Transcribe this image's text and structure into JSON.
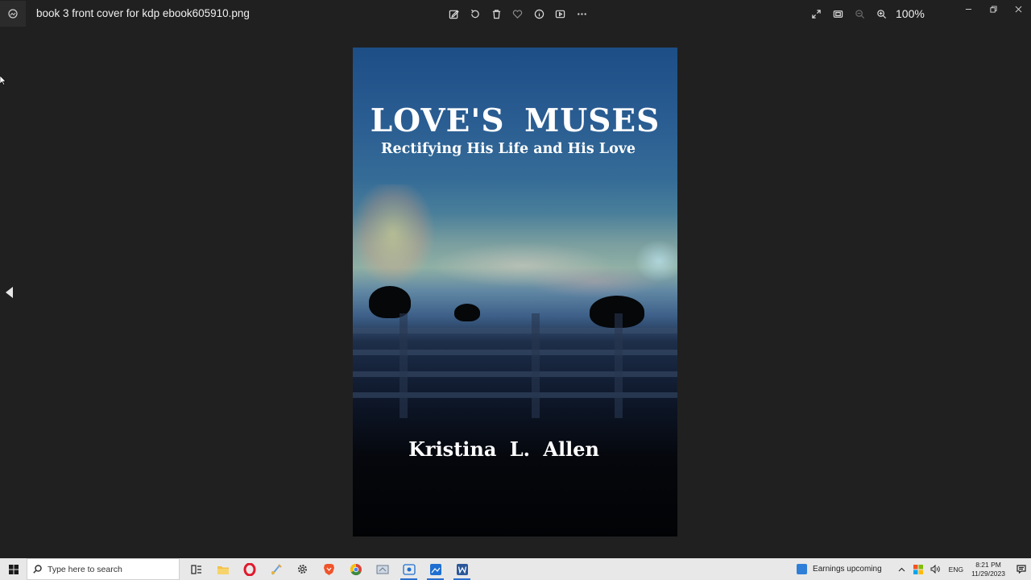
{
  "window": {
    "title": "book 3 front cover for kdp ebook605910.png",
    "zoom": "100%"
  },
  "toolbar": {
    "buttons": [
      "edit-icon",
      "rotate-icon",
      "delete-icon",
      "favorite-icon",
      "info-icon",
      "slideshow-icon",
      "more-icon"
    ]
  },
  "cover": {
    "title": "LOVE'S  MUSES",
    "subtitle": "Rectifying His Life and His Love",
    "author": "Kristina  L.  Allen"
  },
  "taskbar": {
    "search_placeholder": "Type here to search",
    "news": "Earnings upcoming",
    "language": "ENG",
    "time": "8:21 PM",
    "date": "11/29/2023",
    "colors": {
      "opera": "#e0192b",
      "brave": "#f0542a",
      "chrome": "#3b8b3f",
      "word": "#2b579a",
      "photos": "#1e6fd0"
    }
  }
}
